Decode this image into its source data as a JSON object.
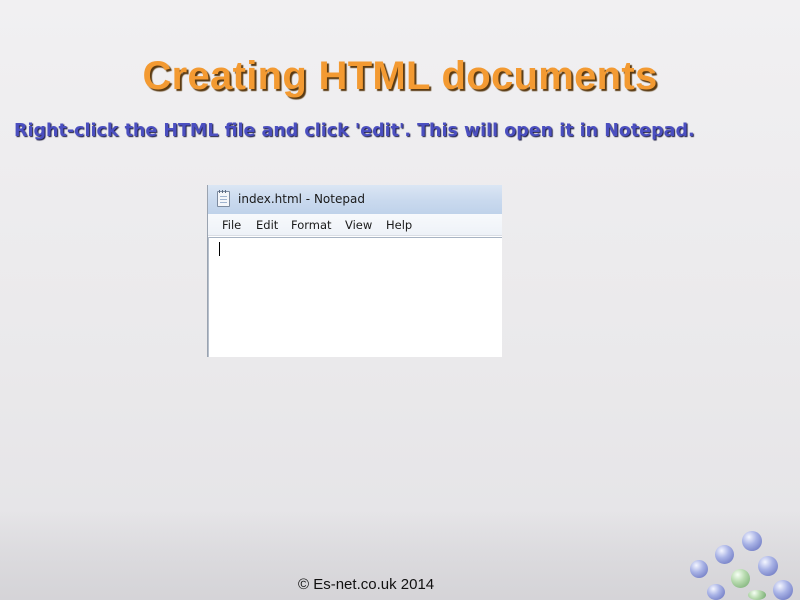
{
  "slide": {
    "title": "Creating HTML documents",
    "instruction": "Right-click the HTML file and click 'edit'. This will open it in Notepad.",
    "copyright": "© Es-net.co.uk 2014"
  },
  "notepad": {
    "window_title": "index.html - Notepad",
    "menu": [
      "File",
      "Edit",
      "Format",
      "View",
      "Help"
    ],
    "content": ""
  },
  "colors": {
    "title": "#f39a32",
    "instruction": "#4b4fc0",
    "background": "#ecebed"
  },
  "icons": {
    "app_icon": "notepad-icon",
    "logo": "bubble-cluster-logo"
  }
}
